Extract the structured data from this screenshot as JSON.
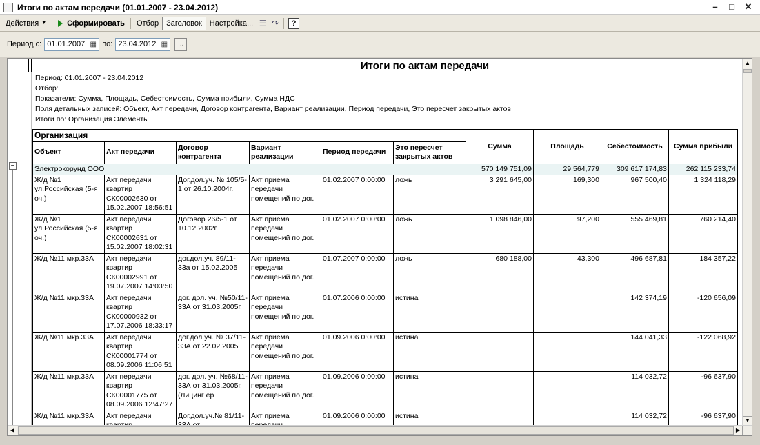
{
  "window": {
    "title": "Итоги по актам передачи (01.01.2007 - 23.04.2012)"
  },
  "toolbar": {
    "actions": "Действия",
    "generate": "Сформировать",
    "filter": "Отбор",
    "header": "Заголовок",
    "settings": "Настройка...",
    "help": "?"
  },
  "period": {
    "from_label": "Период с:",
    "from_value": "01.01.2007",
    "to_label": "по:",
    "to_value": "23.04.2012",
    "more": "..."
  },
  "report": {
    "title": "Итоги по актам передачи",
    "meta": [
      "Период: 01.01.2007 - 23.04.2012",
      "Отбор:",
      "Показатели:  Сумма, Площадь, Себестоимость, Сумма прибыли, Сумма НДС",
      "Поля детальных записей:  Объект, Акт передачи, Договор контрагента, Вариант реализации, Период передачи, Это пересчет закрытых актов",
      "Итоги по:  Организация Элементы"
    ],
    "org_header": "Организация",
    "columns": [
      "Объект",
      "Акт передачи",
      "Договор контрагента",
      "Вариант реализации",
      "Период передачи",
      "Это пересчет закрытых актов",
      "Сумма",
      "Площадь",
      "Себестоимость",
      "Сумма прибыли"
    ],
    "org_row": {
      "name": "Электрокорунд ООО",
      "sum": "570 149 751,09",
      "area": "29 564,779",
      "cost": "309 617 174,83",
      "profit": "262 115 233,74"
    },
    "rows": [
      {
        "obj": "Ж/д №1 ул.Российская (5-я оч.)",
        "act": "Акт передачи квартир СК00002630 от 15.02.2007 18:56:51",
        "contract": "Дог.дол.уч. № 105/5-1 от 26.10.2004г.",
        "variant": "Акт приема передачи помещений по дог.",
        "period": "01.02.2007 0:00:00",
        "recalc": "ложь",
        "sum": "3 291 645,00",
        "area": "169,300",
        "cost": "967 500,40",
        "profit": "1 324 118,29"
      },
      {
        "obj": "Ж/д №1 ул.Российская (5-я оч.)",
        "act": "Акт передачи квартир СК00002631 от 15.02.2007 18:02:31",
        "contract": "Договор 26/5-1 от 10.12.2002г.",
        "variant": "Акт приема передачи помещений по дог.",
        "period": "01.02.2007 0:00:00",
        "recalc": "ложь",
        "sum": "1 098 846,00",
        "area": "97,200",
        "cost": "555 469,81",
        "profit": "760 214,40"
      },
      {
        "obj": "Ж/д №11 мкр.33А",
        "act": "Акт передачи квартир СК00002991 от 19.07.2007 14:03:50",
        "contract": "дог.дол.уч. 89/11-33а от 15.02.2005",
        "variant": "Акт приема передачи помещений по дог.",
        "period": "01.07.2007 0:00:00",
        "recalc": "ложь",
        "sum": "680 188,00",
        "area": "43,300",
        "cost": "496 687,81",
        "profit": "184 357,22"
      },
      {
        "obj": "Ж/д №11 мкр.33А",
        "act": "Акт передачи квартир СК00000932 от 17.07.2006 18:33:17",
        "contract": "дог. дол. уч. №50/11-33А от 31.03.2005г.",
        "variant": "Акт приема передачи помещений по дог.",
        "period": "01.07.2006 0:00:00",
        "recalc": "истина",
        "sum": "",
        "area": "",
        "cost": "142 374,19",
        "profit": "-120 656,09"
      },
      {
        "obj": "Ж/д №11 мкр.33А",
        "act": "Акт передачи квартир СК00001774 от 08.09.2006 11:06:51",
        "contract": "дог.дол.уч. № 37/11-33А от 22.02.2005",
        "variant": "Акт приема передачи помещений по дог.",
        "period": "01.09.2006 0:00:00",
        "recalc": "истина",
        "sum": "",
        "area": "",
        "cost": "144 041,33",
        "profit": "-122 068,92"
      },
      {
        "obj": "Ж/д №11 мкр.33А",
        "act": "Акт передачи квартир СК00001775 от 08.09.2006 12:47:27",
        "contract": "дог. дол. уч. №68/11-33А от 31.03.2005г.(Лицинг ер",
        "variant": "Акт приема передачи помещений по дог.",
        "period": "01.09.2006 0:00:00",
        "recalc": "истина",
        "sum": "",
        "area": "",
        "cost": "114 032,72",
        "profit": "-96 637,90"
      },
      {
        "obj": "Ж/д №11 мкр.33А",
        "act": "Акт передачи квартир",
        "contract": "Дог.дол.уч.№ 81/11-33А от",
        "variant": "Акт приема передачи",
        "period": "01.09.2006 0:00:00",
        "recalc": "истина",
        "sum": "",
        "area": "",
        "cost": "114 032,72",
        "profit": "-96 637,90"
      }
    ]
  }
}
